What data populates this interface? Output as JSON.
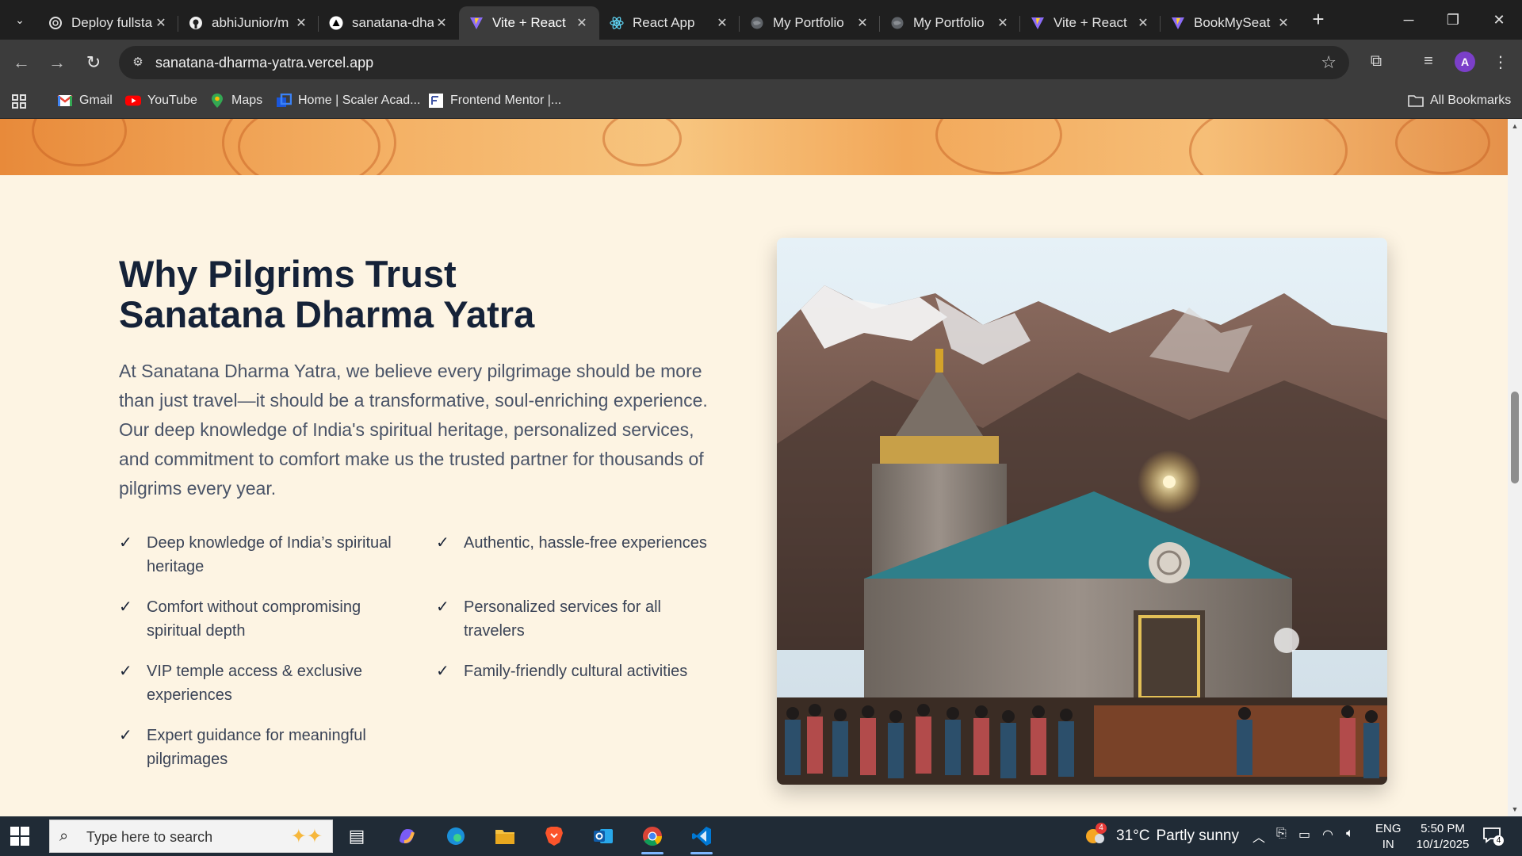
{
  "browser": {
    "tabs": [
      {
        "label": "Deploy fullsta",
        "icon": "openai-icon"
      },
      {
        "label": "abhiJunior/m",
        "icon": "github-icon"
      },
      {
        "label": "sanatana-dha",
        "icon": "vercel-icon"
      },
      {
        "label": "Vite + React",
        "icon": "vite-icon"
      },
      {
        "label": "React App",
        "icon": "react-icon"
      },
      {
        "label": "My Portfolio",
        "icon": "globe-icon"
      },
      {
        "label": "My Portfolio",
        "icon": "globe-icon"
      },
      {
        "label": "Vite + React",
        "icon": "vite-icon"
      },
      {
        "label": "BookMySeat",
        "icon": "vite-icon"
      }
    ],
    "active_tab_index": 3,
    "url": "sanatana-dharma-yatra.vercel.app",
    "profile_initial": "A",
    "bookmarks": [
      {
        "label": "Gmail",
        "icon": "gmail-icon"
      },
      {
        "label": "YouTube",
        "icon": "youtube-icon"
      },
      {
        "label": "Maps",
        "icon": "maps-icon"
      },
      {
        "label": "Home | Scaler Acad...",
        "icon": "scaler-icon"
      },
      {
        "label": "Frontend Mentor |...",
        "icon": "frontend-mentor-icon"
      }
    ],
    "all_bookmarks_label": "All Bookmarks"
  },
  "page": {
    "heading_line1": "Why Pilgrims Trust",
    "heading_line2": "Sanatana Dharma Yatra",
    "intro": "At Sanatana Dharma Yatra, we believe every pilgrimage should be more than just travel—it should be a transformative, soul-enriching experience. Our deep knowledge of India's spiritual heritage, personalized services, and commitment to comfort make us the trusted partner for thousands of pilgrims every year.",
    "features": [
      "Deep knowledge of India’s spiritual heritage",
      "Authentic, hassle-free experiences",
      "Comfort without compromising spiritual depth",
      "Personalized services for all travelers",
      "VIP temple access & exclusive experiences",
      "Family-friendly cultural activities",
      "Expert guidance for meaningful pilgrimages"
    ],
    "scroll_position": 0.39
  },
  "taskbar": {
    "search_placeholder": "Type here to search",
    "weather_badge": "4",
    "temperature": "31°C",
    "weather_text": "Partly sunny",
    "lang_line1": "ENG",
    "lang_line2": "IN",
    "time": "5:50 PM",
    "date": "10/1/2025",
    "notification_count": "4"
  },
  "colors": {
    "page_bg": "#fdf4e3",
    "heading": "#152238",
    "body_text": "#4a5468",
    "banner": "#f2a85a",
    "taskbar": "#202b36"
  }
}
